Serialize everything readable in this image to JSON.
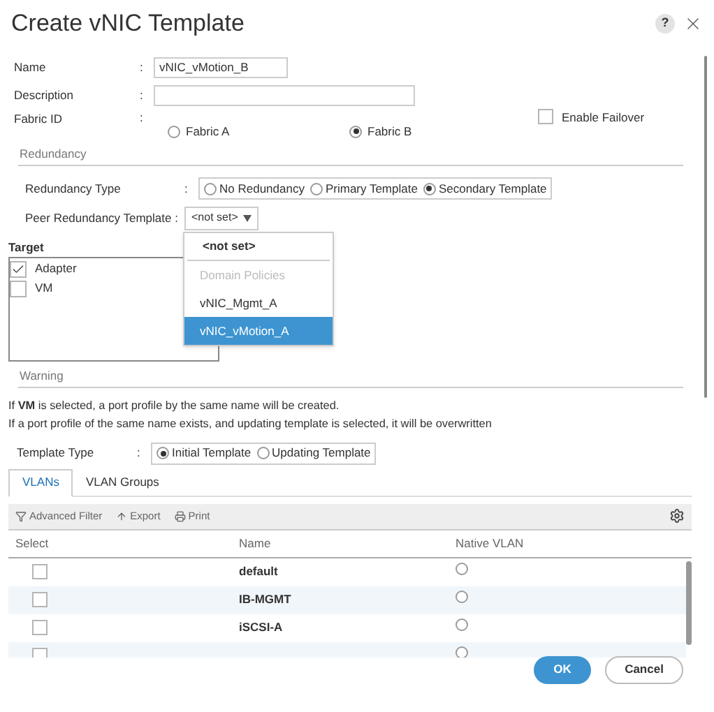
{
  "window": {
    "title": "Create vNIC Template",
    "help": "?"
  },
  "form": {
    "name": {
      "label": "Name",
      "value": "vNIC_vMotion_B"
    },
    "description": {
      "label": "Description"
    },
    "fabric": {
      "label": "Fabric ID",
      "options": [
        {
          "label": "Fabric A",
          "selected": false
        },
        {
          "label": "Fabric B",
          "selected": true
        }
      ]
    },
    "failover": {
      "label": "Enable Failover",
      "checked": false
    },
    "colon": ":"
  },
  "redundancy": {
    "title": "Redundancy",
    "type_label": "Redundancy Type",
    "types": [
      {
        "label": "No Redundancy",
        "selected": false
      },
      {
        "label": "Primary Template",
        "selected": false
      },
      {
        "label": "Secondary Template",
        "selected": true
      }
    ],
    "peer_label": "Peer Redundancy Template :",
    "peer_value": "<not set>",
    "dropdown": [
      {
        "kind": "option",
        "label": "<not set>",
        "selected": false
      },
      {
        "kind": "group",
        "label": "Domain Policies",
        "selected": false
      },
      {
        "kind": "option",
        "label": "vNIC_Mgmt_A",
        "selected": false
      },
      {
        "kind": "option",
        "label": "vNIC_vMotion_A",
        "selected": true
      }
    ]
  },
  "target": {
    "title": "Target",
    "items": [
      {
        "label": "Adapter",
        "checked": true
      },
      {
        "label": "VM",
        "checked": false
      }
    ]
  },
  "warning": {
    "title": "Warning",
    "lines": [
      "If **VM** is selected, a port profile by the same name will be created.",
      "If a port profile of the same name exists, and updating template is selected, it will be overwritten"
    ]
  },
  "template_type": {
    "label": "Template Type",
    "options": [
      {
        "label": "Initial Template",
        "selected": true
      },
      {
        "label": "Updating Template",
        "selected": false
      }
    ]
  },
  "tabs": [
    {
      "label": "VLANs",
      "selected": true
    },
    {
      "label": "VLAN Groups",
      "selected": false
    }
  ],
  "toolbar": [
    "Advanced Filter",
    "Export",
    "Print"
  ],
  "table": {
    "columns": [
      "Select",
      "Name",
      "Native VLAN"
    ],
    "rows": [
      {
        "name": "default",
        "checked": false,
        "native": false
      },
      {
        "name": "IB-MGMT",
        "checked": false,
        "native": false
      },
      {
        "name": "iSCSI-A",
        "checked": false,
        "native": false
      },
      {
        "checked": false,
        "native": false
      }
    ]
  },
  "buttons": [
    {
      "label": "OK",
      "kind": "primary"
    },
    {
      "label": "Cancel",
      "kind": "secondary"
    }
  ]
}
